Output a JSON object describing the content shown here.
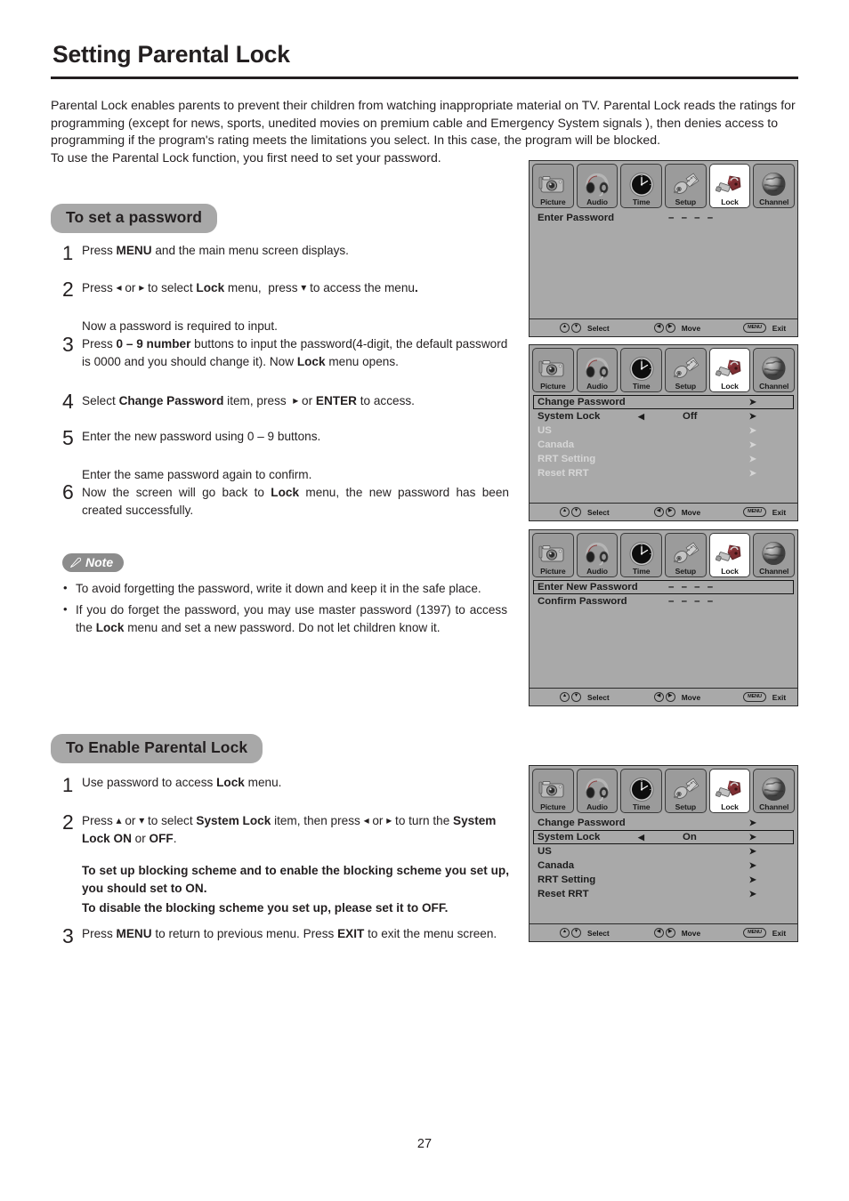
{
  "document": {
    "title": "Setting Parental Lock",
    "page_number": "27",
    "intro": "Parental Lock enables parents to prevent their children from watching inappropriate material on TV. Parental Lock reads the ratings for programming (except for news, sports, unedited movies on premium cable and Emergency System signals ), then denies access to programming if the program's rating meets the limitations you select. In this case, the program will be blocked.",
    "intro2": "To use the Parental Lock function, you first need to set your password."
  },
  "sections": {
    "set_password": {
      "heading": "To set a password",
      "steps": [
        {
          "num": "1",
          "lines": [
            "Press MENU and the main menu screen displays."
          ]
        },
        {
          "num": "2",
          "lines": [
            "Press ◂ or ▸ to select Lock menu,  press ▾ to access the menu."
          ]
        },
        {
          "num": "3",
          "lines": [
            "Now a password is required to input.",
            "Press 0 – 9 number buttons to input the password(4-digit, the default password is 0000 and you should change it). Now Lock menu opens."
          ]
        },
        {
          "num": "4",
          "lines": [
            "Select Change Password item, press  ▸ or ENTER to access."
          ]
        },
        {
          "num": "5",
          "lines": [
            "Enter the new password using 0 – 9 buttons."
          ]
        },
        {
          "num": "6",
          "lines": [
            "Enter the same password again to confirm.",
            "Now the screen will go back to Lock menu, the new password has been created successfully."
          ]
        }
      ]
    },
    "note": {
      "badge": "Note",
      "items": [
        "To avoid forgetting the password, write it down and keep it in the safe place.",
        "If you do forget the password, you may use master password (1397) to access the Lock menu and set a new password. Do not let children know it."
      ]
    },
    "enable_lock": {
      "heading": "To Enable Parental Lock",
      "steps": [
        {
          "num": "1",
          "lines": [
            "Use password to access Lock menu."
          ]
        },
        {
          "num": "2",
          "lines": [
            "Press ▴ or ▾ to select System Lock item, then press ◂ or ▸ to turn the System Lock ON or OFF."
          ]
        },
        {
          "num": "3",
          "lines": [
            "Press MENU to return to previous menu. Press EXIT to exit the menu screen."
          ]
        }
      ],
      "emphasis1": "To set up blocking scheme and to enable the blocking scheme you set up, you should set to ON.",
      "emphasis2": "To disable the blocking scheme you set up, please set it to OFF."
    }
  },
  "osd": {
    "tabs": [
      {
        "label": "Picture",
        "icon": "camera-icon",
        "active": false
      },
      {
        "label": "Audio",
        "icon": "headphones-icon",
        "active": false
      },
      {
        "label": "Time",
        "icon": "clock-icon",
        "active": false
      },
      {
        "label": "Setup",
        "icon": "connector-icon",
        "active": false
      },
      {
        "label": "Lock",
        "icon": "padlock-icon",
        "active": true
      },
      {
        "label": "Channel",
        "icon": "globe-icon",
        "active": false
      }
    ],
    "footer": {
      "select_label": "Select",
      "select_keys": [
        "▲",
        "▼"
      ],
      "move_label": "Move",
      "move_keys": [
        "◀",
        "▶"
      ],
      "exit_label": "Exit",
      "exit_key": "MENU"
    },
    "panels": [
      {
        "id": "enter-password",
        "rows": [
          {
            "label": "Enter Password",
            "dashes": "– – – –",
            "state": "normal"
          }
        ]
      },
      {
        "id": "lock-menu-off",
        "rows": [
          {
            "label": "Change Password",
            "state": "highlight",
            "right_arrow": "➤"
          },
          {
            "label": "System Lock",
            "state": "normal",
            "left_arrow": "◀",
            "value": "Off",
            "right_arrow": "➤"
          },
          {
            "label": "US",
            "state": "dim",
            "right_arrow": "➤"
          },
          {
            "label": "Canada",
            "state": "dim",
            "right_arrow": "➤"
          },
          {
            "label": "RRT Setting",
            "state": "dim",
            "right_arrow": "➤"
          },
          {
            "label": "Reset RRT",
            "state": "dim",
            "right_arrow": "➤"
          }
        ]
      },
      {
        "id": "new-password",
        "rows": [
          {
            "label": "Enter New Password",
            "dashes": "– – – –",
            "state": "highlight"
          },
          {
            "label": "Confirm Password",
            "dashes": "– – – –",
            "state": "normal"
          }
        ]
      },
      {
        "id": "lock-menu-on",
        "rows": [
          {
            "label": "Change Password",
            "state": "normal",
            "right_arrow": "➤"
          },
          {
            "label": "System Lock",
            "state": "highlight",
            "left_arrow": "◀",
            "value": "On",
            "right_arrow": "➤"
          },
          {
            "label": "US",
            "state": "normal",
            "right_arrow": "➤"
          },
          {
            "label": "Canada",
            "state": "normal",
            "right_arrow": "➤"
          },
          {
            "label": "RRT Setting",
            "state": "normal",
            "right_arrow": "➤"
          },
          {
            "label": "Reset RRT",
            "state": "normal",
            "right_arrow": "➤"
          }
        ]
      }
    ]
  },
  "colors": {
    "osd_background": "#a9a9a9",
    "osd_tab": "#9b9b9b",
    "pill": "#a8a8a8",
    "note_badge": "#8c8c8c",
    "text": "#231f20"
  }
}
